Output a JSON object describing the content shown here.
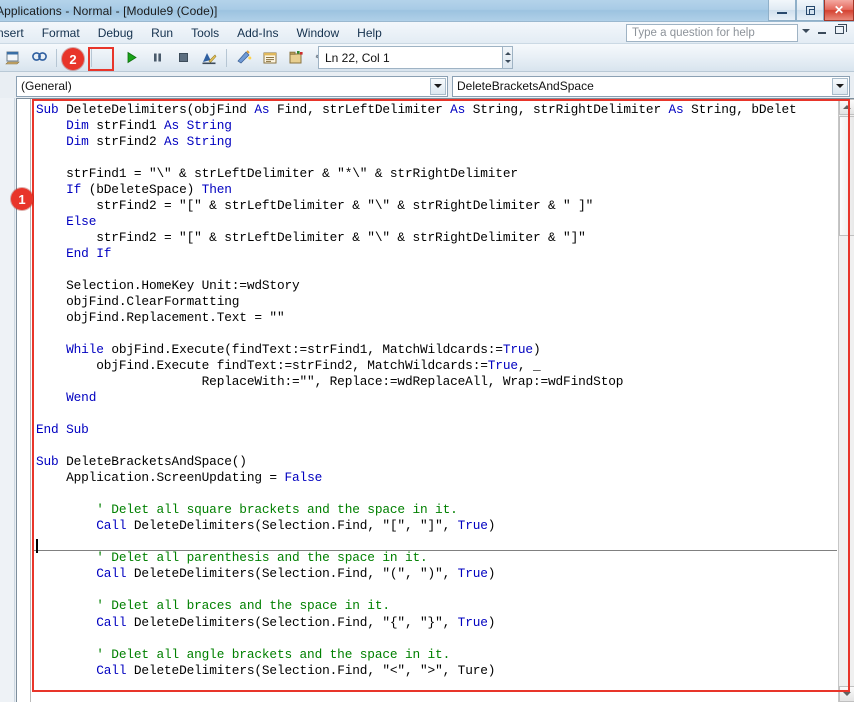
{
  "window": {
    "title": "Applications - Normal - [Module9 (Code)]",
    "minimize_label": "Minimize",
    "restore_label": "Restore",
    "close_label": "✕"
  },
  "menubar": {
    "items": [
      {
        "label": "nsert"
      },
      {
        "label": "Format"
      },
      {
        "label": "Debug"
      },
      {
        "label": "Run"
      },
      {
        "label": "Tools"
      },
      {
        "label": "Add-Ins"
      },
      {
        "label": "Window"
      },
      {
        "label": "Help"
      }
    ]
  },
  "help_search": {
    "placeholder": "Type a question for help",
    "value": "Type a question for help"
  },
  "toolbar": {
    "buttons": [
      {
        "name": "view-word-icon",
        "label": "View Microsoft Word"
      },
      {
        "name": "find-icon",
        "label": "Find"
      },
      {
        "name": "undo-icon",
        "label": "Undo"
      },
      {
        "name": "run-icon",
        "label": "Run Sub/UserForm"
      },
      {
        "name": "break-icon",
        "label": "Break"
      },
      {
        "name": "reset-icon",
        "label": "Reset"
      },
      {
        "name": "design-mode-icon",
        "label": "Design Mode"
      },
      {
        "name": "project-explorer-icon",
        "label": "Project Explorer"
      },
      {
        "name": "properties-window-icon",
        "label": "Properties Window"
      },
      {
        "name": "object-browser-icon",
        "label": "Object Browser"
      },
      {
        "name": "toolbox-icon",
        "label": "Toolbox"
      },
      {
        "name": "help-icon",
        "label": "Help"
      }
    ],
    "status_value": "Ln 22, Col 1"
  },
  "combobar": {
    "object_combo": "(General)",
    "procedure_combo": "DeleteBracketsAndSpace"
  },
  "annotations": [
    {
      "id": "1",
      "label": "1",
      "target": "code-region"
    },
    {
      "id": "2",
      "label": "2",
      "target": "run-button"
    }
  ],
  "colors": {
    "annotation_red": "#e8352a",
    "keyword_blue": "#0000C0",
    "comment_green": "#008000",
    "code_black": "#000000"
  },
  "code": {
    "lines": [
      [
        {
          "t": "Sub ",
          "c": "kw"
        },
        {
          "t": "DeleteDelimiters(objFind ",
          "c": "tx"
        },
        {
          "t": "As ",
          "c": "kw"
        },
        {
          "t": "Find, strLeftDelimiter ",
          "c": "tx"
        },
        {
          "t": "As ",
          "c": "kw"
        },
        {
          "t": "String, strRightDelimiter ",
          "c": "tx"
        },
        {
          "t": "As ",
          "c": "kw"
        },
        {
          "t": "String, bDelet",
          "c": "tx"
        }
      ],
      [
        {
          "t": "    ",
          "c": "tx"
        },
        {
          "t": "Dim ",
          "c": "kw"
        },
        {
          "t": "strFind1 ",
          "c": "tx"
        },
        {
          "t": "As String",
          "c": "kw"
        }
      ],
      [
        {
          "t": "    ",
          "c": "tx"
        },
        {
          "t": "Dim ",
          "c": "kw"
        },
        {
          "t": "strFind2 ",
          "c": "tx"
        },
        {
          "t": "As String",
          "c": "kw"
        }
      ],
      [
        {
          "t": "",
          "c": "tx"
        }
      ],
      [
        {
          "t": "    strFind1 = \"\\\" & strLeftDelimiter & \"*\\\" & strRightDelimiter",
          "c": "tx"
        }
      ],
      [
        {
          "t": "    ",
          "c": "tx"
        },
        {
          "t": "If ",
          "c": "kw"
        },
        {
          "t": "(bDeleteSpace) ",
          "c": "tx"
        },
        {
          "t": "Then",
          "c": "kw"
        }
      ],
      [
        {
          "t": "        strFind2 = \"[\" & strLeftDelimiter & \"\\\" & strRightDelimiter & \" ]\"",
          "c": "tx"
        }
      ],
      [
        {
          "t": "    ",
          "c": "tx"
        },
        {
          "t": "Else",
          "c": "kw"
        }
      ],
      [
        {
          "t": "        strFind2 = \"[\" & strLeftDelimiter & \"\\\" & strRightDelimiter & \"]\"",
          "c": "tx"
        }
      ],
      [
        {
          "t": "    ",
          "c": "tx"
        },
        {
          "t": "End If",
          "c": "kw"
        }
      ],
      [
        {
          "t": "",
          "c": "tx"
        }
      ],
      [
        {
          "t": "    Selection.HomeKey Unit:=wdStory",
          "c": "tx"
        }
      ],
      [
        {
          "t": "    objFind.ClearFormatting",
          "c": "tx"
        }
      ],
      [
        {
          "t": "    objFind.Replacement.Text = \"\"",
          "c": "tx"
        }
      ],
      [
        {
          "t": "",
          "c": "tx"
        }
      ],
      [
        {
          "t": "    ",
          "c": "tx"
        },
        {
          "t": "While ",
          "c": "kw"
        },
        {
          "t": "objFind.Execute(findText:=strFind1, MatchWildcards:=",
          "c": "tx"
        },
        {
          "t": "True",
          "c": "kw"
        },
        {
          "t": ")",
          "c": "tx"
        }
      ],
      [
        {
          "t": "        objFind.Execute findText:=strFind2, MatchWildcards:=",
          "c": "tx"
        },
        {
          "t": "True",
          "c": "kw"
        },
        {
          "t": ", _",
          "c": "tx"
        }
      ],
      [
        {
          "t": "                      ReplaceWith:=\"\", Replace:=wdReplaceAll, Wrap:=wdFindStop",
          "c": "tx"
        }
      ],
      [
        {
          "t": "    ",
          "c": "tx"
        },
        {
          "t": "Wend",
          "c": "kw"
        }
      ],
      [
        {
          "t": "",
          "c": "tx"
        }
      ],
      [
        {
          "t": "End Sub",
          "c": "kw"
        }
      ],
      [
        {
          "t": "",
          "c": "tx"
        }
      ],
      [
        {
          "t": "Sub ",
          "c": "kw"
        },
        {
          "t": "DeleteBracketsAndSpace()",
          "c": "tx"
        }
      ],
      [
        {
          "t": "    Application.ScreenUpdating = ",
          "c": "tx"
        },
        {
          "t": "False",
          "c": "kw"
        }
      ],
      [
        {
          "t": "",
          "c": "tx"
        }
      ],
      [
        {
          "t": "        ' Delet all square brackets and the space in it.",
          "c": "cm"
        }
      ],
      [
        {
          "t": "        ",
          "c": "tx"
        },
        {
          "t": "Call ",
          "c": "kw"
        },
        {
          "t": "DeleteDelimiters(Selection.Find, \"[\", \"]\", ",
          "c": "tx"
        },
        {
          "t": "True",
          "c": "kw"
        },
        {
          "t": ")",
          "c": "tx"
        }
      ],
      [
        {
          "t": "",
          "c": "tx"
        }
      ],
      [
        {
          "t": "        ' Delet all parenthesis and the space in it.",
          "c": "cm"
        }
      ],
      [
        {
          "t": "        ",
          "c": "tx"
        },
        {
          "t": "Call ",
          "c": "kw"
        },
        {
          "t": "DeleteDelimiters(Selection.Find, \"(\", \")\", ",
          "c": "tx"
        },
        {
          "t": "True",
          "c": "kw"
        },
        {
          "t": ")",
          "c": "tx"
        }
      ],
      [
        {
          "t": "",
          "c": "tx"
        }
      ],
      [
        {
          "t": "        ' Delet all braces and the space in it.",
          "c": "cm"
        }
      ],
      [
        {
          "t": "        ",
          "c": "tx"
        },
        {
          "t": "Call ",
          "c": "kw"
        },
        {
          "t": "DeleteDelimiters(Selection.Find, \"{\", \"}\", ",
          "c": "tx"
        },
        {
          "t": "True",
          "c": "kw"
        },
        {
          "t": ")",
          "c": "tx"
        }
      ],
      [
        {
          "t": "",
          "c": "tx"
        }
      ],
      [
        {
          "t": "        ' Delet all angle brackets and the space in it.",
          "c": "cm"
        }
      ],
      [
        {
          "t": "        ",
          "c": "tx"
        },
        {
          "t": "Call ",
          "c": "kw"
        },
        {
          "t": "DeleteDelimiters(Selection.Find, \"<\", \">\", Ture)",
          "c": "tx"
        }
      ]
    ]
  }
}
